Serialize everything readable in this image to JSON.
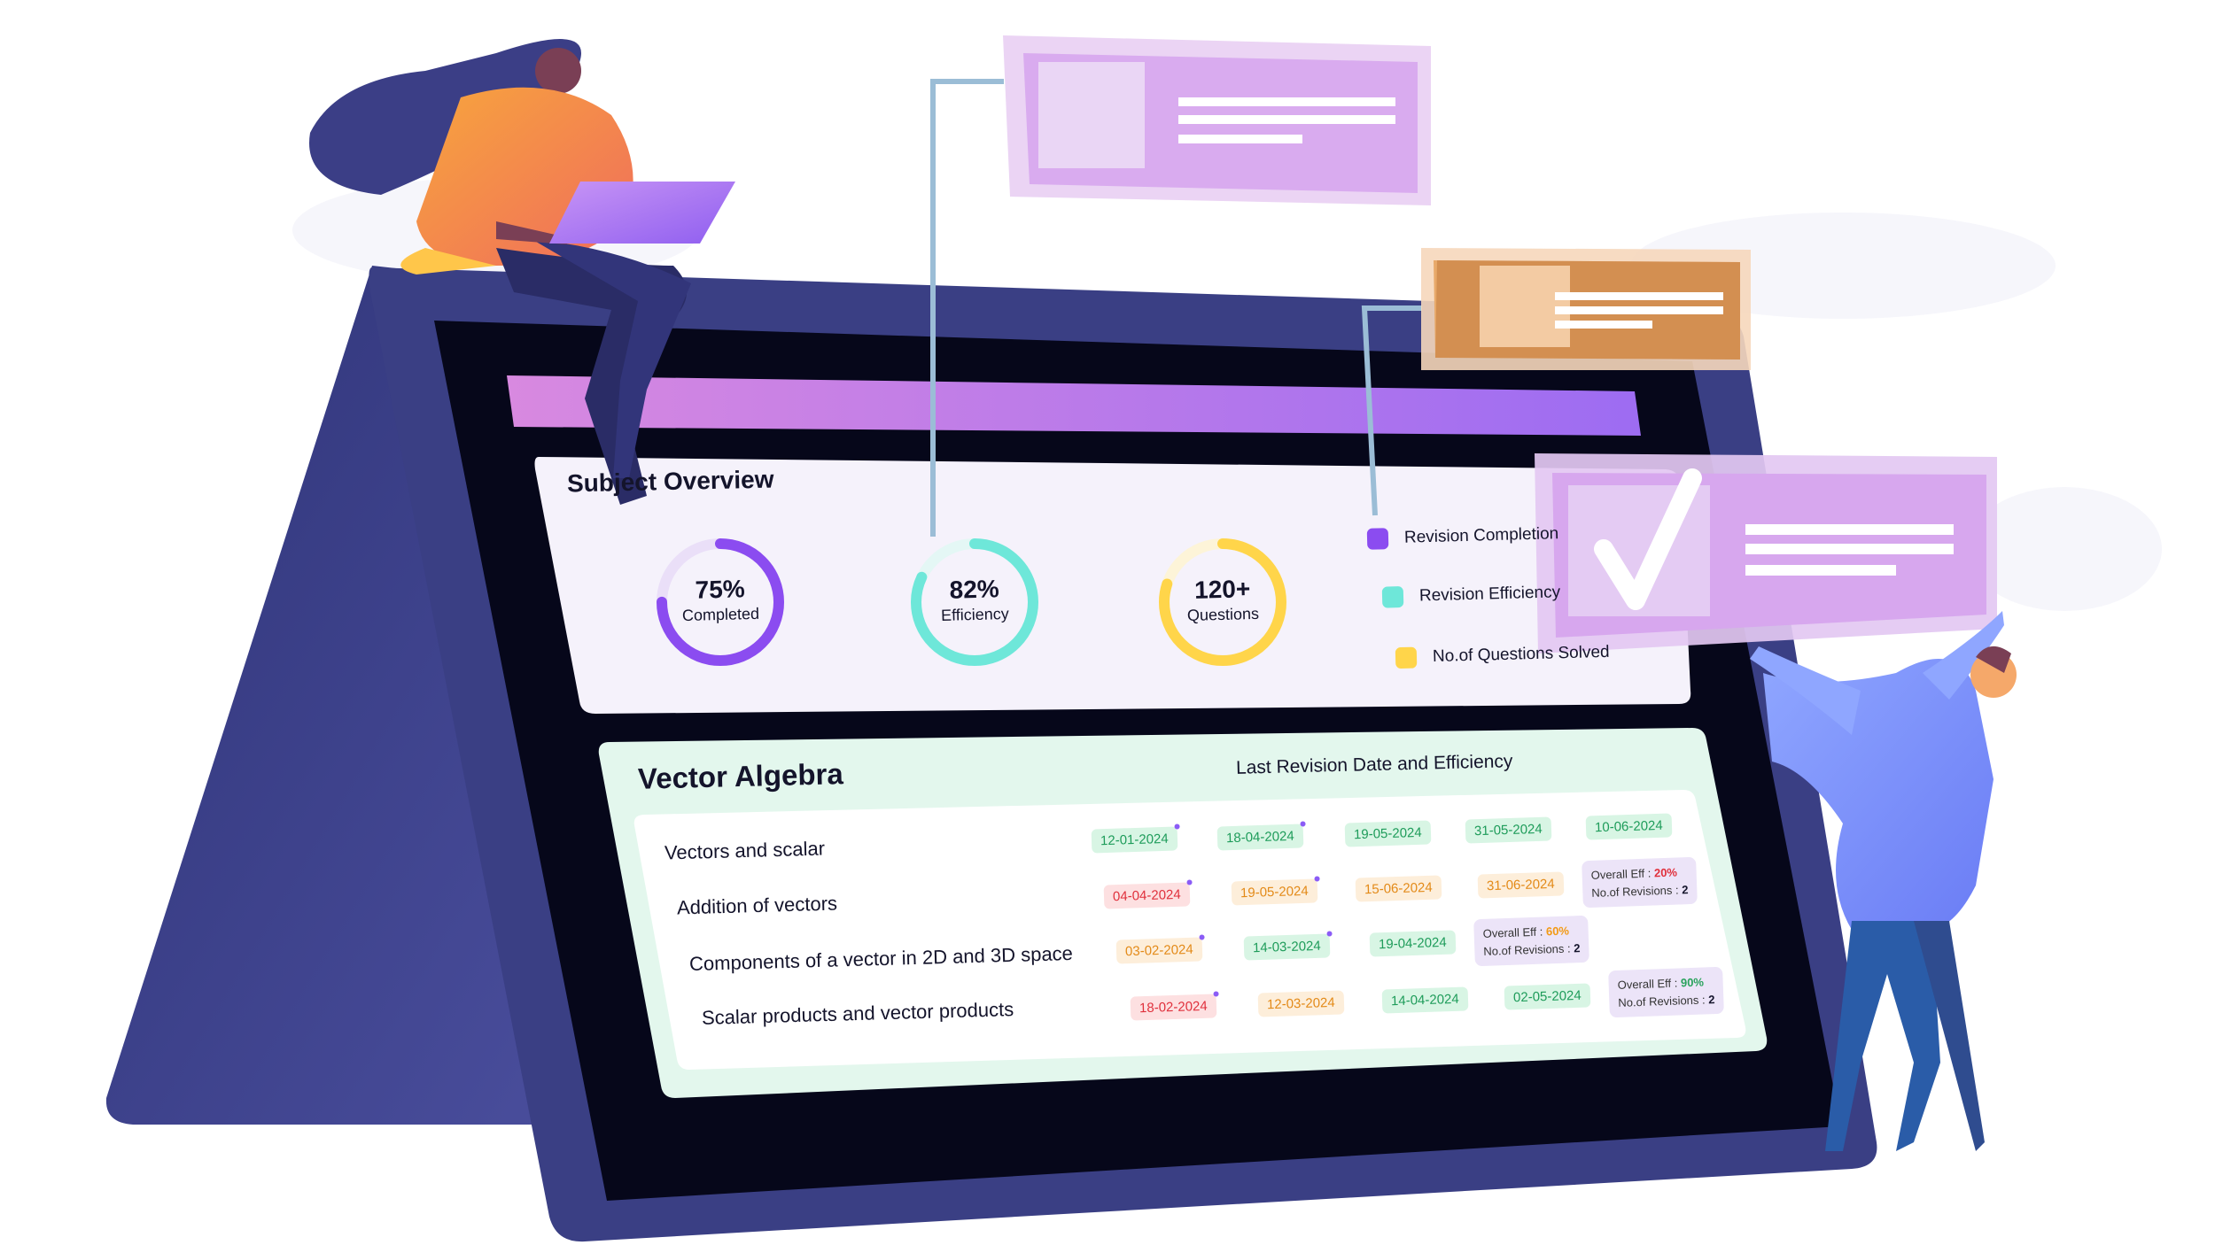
{
  "overview": {
    "title": "Subject Overview",
    "rings": [
      {
        "value": "75%",
        "label": "Completed",
        "color": "#8b4cf0",
        "fraction": 0.75
      },
      {
        "value": "82%",
        "label": "Efficiency",
        "color": "#6ee7d9",
        "fraction": 0.82
      },
      {
        "value": "120+",
        "label": "Questions",
        "color": "#ffd54a",
        "fraction": 0.8
      }
    ],
    "legend": [
      {
        "label": "Revision Completion",
        "color": "#8b4cf0"
      },
      {
        "label": "Revision Efficiency",
        "color": "#6ee7d9"
      },
      {
        "label": "No.of Questions Solved",
        "color": "#ffd54a"
      }
    ]
  },
  "subject": {
    "title": "Vector Algebra",
    "subtitle": "Last Revision Date and Efficiency",
    "topics": [
      {
        "name": "Vectors and scalar",
        "dates": [
          {
            "d": "12-01-2024",
            "c": "green"
          },
          {
            "d": "18-04-2024",
            "c": "green"
          },
          {
            "d": "19-05-2024",
            "c": "green"
          },
          {
            "d": "31-05-2024",
            "c": "green"
          },
          {
            "d": "10-06-2024",
            "c": "green"
          }
        ]
      },
      {
        "name": "Addition of vectors",
        "dates": [
          {
            "d": "04-04-2024",
            "c": "red"
          },
          {
            "d": "19-05-2024",
            "c": "orange"
          },
          {
            "d": "15-06-2024",
            "c": "orange"
          },
          {
            "d": "31-06-2024",
            "c": "orange"
          }
        ],
        "summary": {
          "eff_label": "Overall Eff :",
          "eff": "20%",
          "rev_label": "No.of Revisions :",
          "rev": "2"
        }
      },
      {
        "name": "Components of a vector  in 2D and 3D space",
        "dates": [
          {
            "d": "03-02-2024",
            "c": "orange"
          },
          {
            "d": "14-03-2024",
            "c": "green"
          },
          {
            "d": "19-04-2024",
            "c": "green"
          }
        ],
        "summary": {
          "eff_label": "Overall Eff :",
          "eff": "60%",
          "rev_label": "No.of Revisions :",
          "rev": "2"
        }
      },
      {
        "name": "Scalar products and vector products",
        "dates": [
          {
            "d": "18-02-2024",
            "c": "red"
          },
          {
            "d": "12-03-2024",
            "c": "orange"
          },
          {
            "d": "14-04-2024",
            "c": "green"
          },
          {
            "d": "02-05-2024",
            "c": "green"
          }
        ],
        "summary": {
          "eff_label": "Overall Eff :",
          "eff": "90%",
          "rev_label": "No.of Revisions :",
          "rev": "2"
        }
      }
    ]
  },
  "colors": {
    "device_frame": "#3a3f84",
    "device_side": "#4a4f98",
    "screen": "#06071a",
    "header_bar_start": "#d889e0",
    "header_bar_end": "#9d6cf2",
    "overview_card": "#f5f2fb",
    "table_card": "#e3f7ed",
    "float_card_purple": "#dcb3ee",
    "float_card_orange": "#e8a96a",
    "connector": "#9bbdd6"
  }
}
